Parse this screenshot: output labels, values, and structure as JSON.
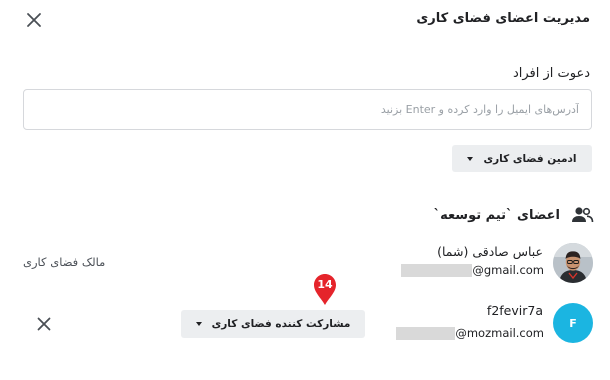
{
  "dialog": {
    "title": "مدیریت اعضای فضای کاری",
    "close_icon": "close-icon"
  },
  "invite": {
    "label": "دعوت از افراد",
    "placeholder": "آدرس‌های ایمیل را وارد کرده و Enter بزنید",
    "value": "",
    "role_label": "ادمین فضای کاری"
  },
  "members": {
    "heading": "اعضای `تیم توسعه`",
    "heading_icon": "people-icon",
    "list": [
      {
        "name": "عباس صادقی (شما)",
        "email_suffix": "@gmail.com",
        "role_text": "مالک فضای کاری",
        "avatar": "profile-photo"
      },
      {
        "name": "f2fevir7a",
        "email_suffix": "@mozmail.com",
        "role_label": "مشارکت کننده فضای کاری",
        "avatar_initial": "F",
        "avatar_color": "#1bb5e1"
      }
    ]
  },
  "annotation": {
    "step_badge": "14",
    "badge_color": "#e5242b"
  }
}
